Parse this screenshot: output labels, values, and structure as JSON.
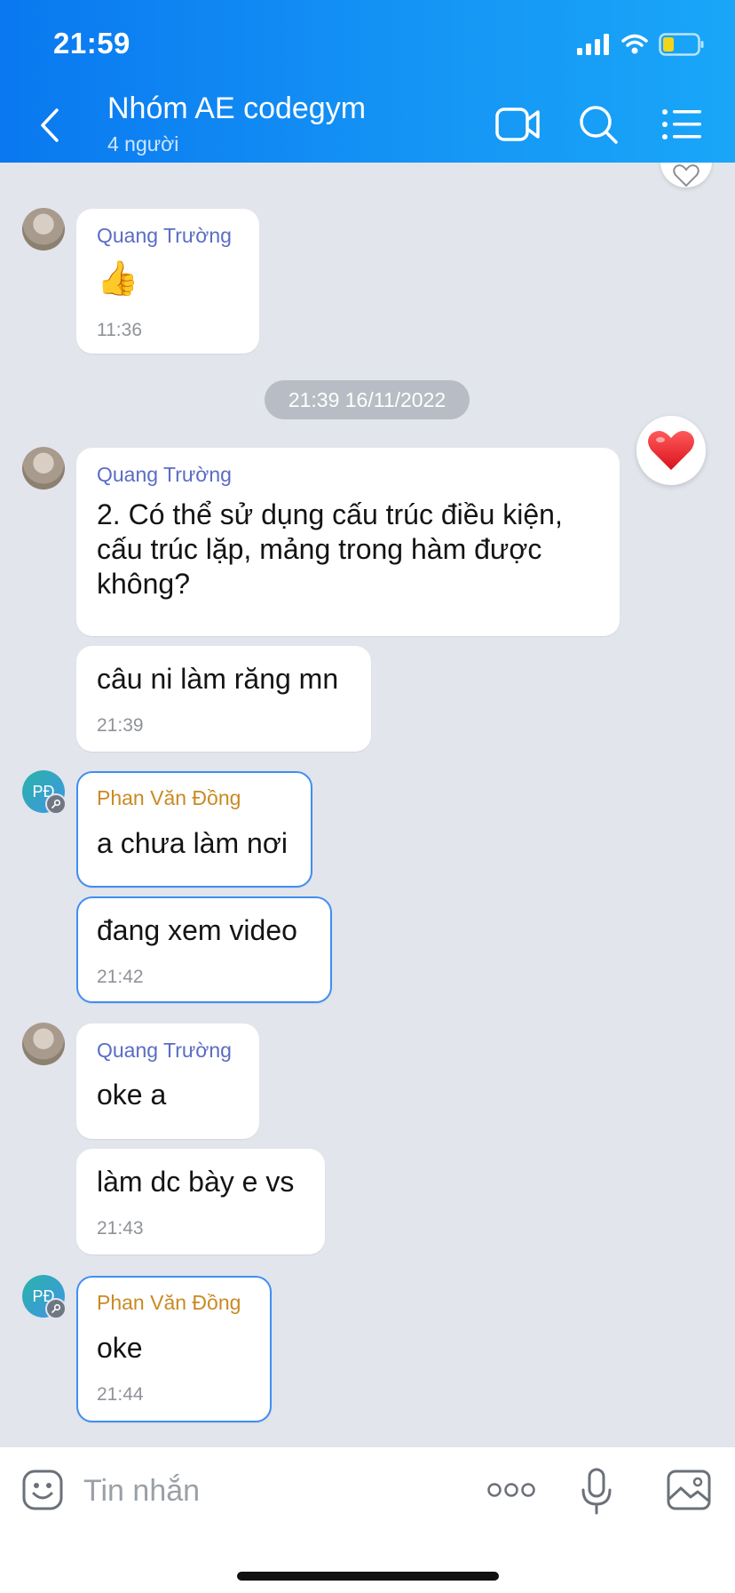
{
  "status_bar": {
    "time": "21:59"
  },
  "header": {
    "title": "Nhóm AE codegym",
    "subtitle": "4 người"
  },
  "date_separator": "21:39 16/11/2022",
  "messages": [
    {
      "sender": "Quang Trường",
      "text": "👍",
      "time": "11:36"
    },
    {
      "sender": "Quang Trường",
      "text_lines": [
        "2. Có thể sử dụng cấu trúc điều kiện,",
        "cấu trúc lặp, mảng trong hàm được",
        "không?"
      ],
      "reaction": "heart"
    },
    {
      "text": "câu ni làm răng mn",
      "time": "21:39"
    },
    {
      "sender": "Phan Văn Đồng",
      "avatar_initials": "PĐ",
      "text": "a chưa làm nơi"
    },
    {
      "text": "đang xem video",
      "time": "21:42"
    },
    {
      "sender": "Quang Trường",
      "text": "oke a"
    },
    {
      "text": "làm dc bày e vs",
      "time": "21:43"
    },
    {
      "sender": "Phan Văn Đồng",
      "avatar_initials": "PĐ",
      "text": "oke",
      "time": "21:44"
    }
  ],
  "composer": {
    "placeholder": "Tin nhắn"
  },
  "colors": {
    "header_start": "#0a78f0",
    "header_end": "#19a6f8",
    "chat_bg": "#e2e5ec",
    "sender_blue": "#5a6cc4",
    "sender_orange": "#c98a23",
    "own_bubble_border": "#3f8ef2"
  },
  "icons": [
    "back-icon",
    "video-call-icon",
    "search-icon",
    "menu-list-icon",
    "emoji-icon",
    "more-icon",
    "mic-icon",
    "image-icon",
    "heart-icon",
    "signal-icon",
    "wifi-icon",
    "battery-icon"
  ]
}
